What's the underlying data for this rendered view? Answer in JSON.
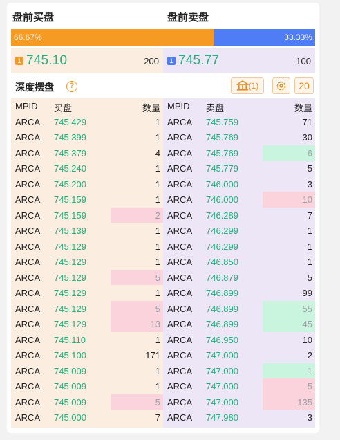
{
  "header": {
    "bid_title": "盘前买盘",
    "ask_title": "盘前卖盘"
  },
  "ratio": {
    "buy_percent_label": "66.67%",
    "sell_percent_label": "33.33%",
    "buy_fraction": 0.6667,
    "buy_color": "#f59a23",
    "sell_color": "#4f7df5"
  },
  "best_bid": {
    "badge": "1",
    "price": "745.10",
    "qty": "200"
  },
  "best_ask": {
    "badge": "1",
    "price": "745.77",
    "qty": "100"
  },
  "depth": {
    "title": "深度摆盘",
    "help_icon": "?",
    "bank_count": "(1)",
    "level": "20"
  },
  "columns": {
    "mpid": "MPID",
    "bid_price": "买盘",
    "ask_price": "卖盘",
    "qty": "数量"
  },
  "bids": [
    {
      "mpid": "ARCA",
      "price": "745.429",
      "qty": "1",
      "hl": ""
    },
    {
      "mpid": "ARCA",
      "price": "745.399",
      "qty": "1",
      "hl": ""
    },
    {
      "mpid": "ARCA",
      "price": "745.379",
      "qty": "4",
      "hl": ""
    },
    {
      "mpid": "ARCA",
      "price": "745.240",
      "qty": "1",
      "hl": ""
    },
    {
      "mpid": "ARCA",
      "price": "745.200",
      "qty": "1",
      "hl": ""
    },
    {
      "mpid": "ARCA",
      "price": "745.159",
      "qty": "1",
      "hl": ""
    },
    {
      "mpid": "ARCA",
      "price": "745.159",
      "qty": "2",
      "hl": "red"
    },
    {
      "mpid": "ARCA",
      "price": "745.139",
      "qty": "1",
      "hl": ""
    },
    {
      "mpid": "ARCA",
      "price": "745.129",
      "qty": "1",
      "hl": ""
    },
    {
      "mpid": "ARCA",
      "price": "745.129",
      "qty": "1",
      "hl": ""
    },
    {
      "mpid": "ARCA",
      "price": "745.129",
      "qty": "5",
      "hl": "red"
    },
    {
      "mpid": "ARCA",
      "price": "745.129",
      "qty": "1",
      "hl": ""
    },
    {
      "mpid": "ARCA",
      "price": "745.129",
      "qty": "5",
      "hl": "red"
    },
    {
      "mpid": "ARCA",
      "price": "745.129",
      "qty": "13",
      "hl": "red"
    },
    {
      "mpid": "ARCA",
      "price": "745.110",
      "qty": "1",
      "hl": ""
    },
    {
      "mpid": "ARCA",
      "price": "745.100",
      "qty": "171",
      "hl": ""
    },
    {
      "mpid": "ARCA",
      "price": "745.009",
      "qty": "1",
      "hl": ""
    },
    {
      "mpid": "ARCA",
      "price": "745.009",
      "qty": "1",
      "hl": ""
    },
    {
      "mpid": "ARCA",
      "price": "745.009",
      "qty": "5",
      "hl": "red"
    },
    {
      "mpid": "ARCA",
      "price": "745.000",
      "qty": "7",
      "hl": ""
    }
  ],
  "asks": [
    {
      "mpid": "ARCA",
      "price": "745.759",
      "qty": "71",
      "hl": ""
    },
    {
      "mpid": "ARCA",
      "price": "745.769",
      "qty": "30",
      "hl": ""
    },
    {
      "mpid": "ARCA",
      "price": "745.769",
      "qty": "6",
      "hl": "green"
    },
    {
      "mpid": "ARCA",
      "price": "745.779",
      "qty": "5",
      "hl": ""
    },
    {
      "mpid": "ARCA",
      "price": "746.000",
      "qty": "3",
      "hl": ""
    },
    {
      "mpid": "ARCA",
      "price": "746.000",
      "qty": "10",
      "hl": "red"
    },
    {
      "mpid": "ARCA",
      "price": "746.289",
      "qty": "7",
      "hl": ""
    },
    {
      "mpid": "ARCA",
      "price": "746.299",
      "qty": "1",
      "hl": ""
    },
    {
      "mpid": "ARCA",
      "price": "746.299",
      "qty": "1",
      "hl": ""
    },
    {
      "mpid": "ARCA",
      "price": "746.850",
      "qty": "1",
      "hl": ""
    },
    {
      "mpid": "ARCA",
      "price": "746.879",
      "qty": "5",
      "hl": ""
    },
    {
      "mpid": "ARCA",
      "price": "746.899",
      "qty": "99",
      "hl": ""
    },
    {
      "mpid": "ARCA",
      "price": "746.899",
      "qty": "55",
      "hl": "green"
    },
    {
      "mpid": "ARCA",
      "price": "746.899",
      "qty": "45",
      "hl": "green"
    },
    {
      "mpid": "ARCA",
      "price": "746.950",
      "qty": "10",
      "hl": ""
    },
    {
      "mpid": "ARCA",
      "price": "747.000",
      "qty": "2",
      "hl": ""
    },
    {
      "mpid": "ARCA",
      "price": "747.000",
      "qty": "1",
      "hl": "green"
    },
    {
      "mpid": "ARCA",
      "price": "747.000",
      "qty": "5",
      "hl": "red"
    },
    {
      "mpid": "ARCA",
      "price": "747.000",
      "qty": "135",
      "hl": "red"
    },
    {
      "mpid": "ARCA",
      "price": "747.980",
      "qty": "3",
      "hl": ""
    }
  ]
}
